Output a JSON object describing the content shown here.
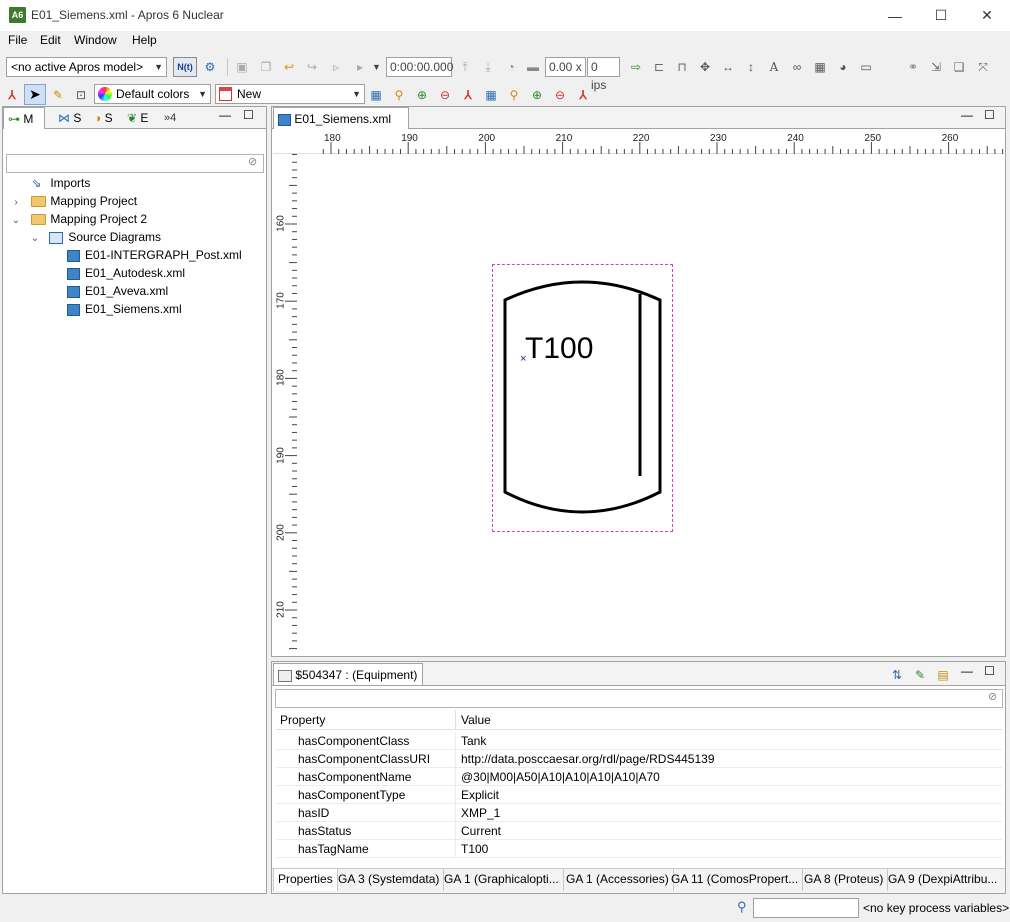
{
  "window": {
    "icon_text": "A6",
    "title": "E01_Siemens.xml - Apros 6 Nuclear",
    "minimize_glyph": "—",
    "maximize_glyph": "☐",
    "close_glyph": "✕"
  },
  "menu": [
    "File",
    "Edit",
    "Window",
    "Help"
  ],
  "toolbar1": {
    "model_combo": "<no active Apros model>",
    "time_field": "0:00:00.000",
    "speed_field": "0.00 x",
    "ips_field": "0 ips",
    "n_button": "N(t)"
  },
  "toolbar2": {
    "colors_combo": "Default colors",
    "new_combo": "New"
  },
  "left_panel": {
    "tabs": [
      "M",
      "S",
      "S",
      "E",
      "»4"
    ],
    "filter_placeholder": "",
    "tree": [
      {
        "label": "Imports",
        "type": "imports",
        "depth": 0,
        "expander": ""
      },
      {
        "label": "Mapping Project",
        "type": "folder",
        "depth": 0,
        "expander": "›"
      },
      {
        "label": "Mapping Project 2",
        "type": "folder",
        "depth": 0,
        "expander": "⌄"
      },
      {
        "label": "Source Diagrams",
        "type": "diagrams",
        "depth": 1,
        "expander": "⌄"
      },
      {
        "label": "E01-INTERGRAPH_Post.xml",
        "type": "diagram",
        "depth": 2,
        "expander": ""
      },
      {
        "label": "E01_Autodesk.xml",
        "type": "diagram",
        "depth": 2,
        "expander": ""
      },
      {
        "label": "E01_Aveva.xml",
        "type": "diagram",
        "depth": 2,
        "expander": ""
      },
      {
        "label": "E01_Siemens.xml",
        "type": "diagram",
        "depth": 2,
        "expander": ""
      }
    ]
  },
  "editor": {
    "tab_label": "E01_Siemens.xml",
    "ruler_top": [
      "180",
      "190",
      "200",
      "210",
      "220",
      "230",
      "240",
      "250",
      "260"
    ],
    "ruler_left": [
      "160",
      "170",
      "180",
      "190",
      "200",
      "210"
    ],
    "tank_label": "T100"
  },
  "properties": {
    "tab_label": "$504347 : (Equipment)",
    "col_property": "Property",
    "col_value": "Value",
    "rows": [
      {
        "key": "hasComponentClass",
        "value": "Tank"
      },
      {
        "key": "hasComponentClassURI",
        "value": "http://data.posccaesar.org/rdl/page/RDS445139"
      },
      {
        "key": "hasComponentName",
        "value": "@30|M00|A50|A10|A10|A10|A10|A70"
      },
      {
        "key": "hasComponentType",
        "value": "Explicit"
      },
      {
        "key": "hasID",
        "value": "XMP_1"
      },
      {
        "key": "hasStatus",
        "value": "Current"
      },
      {
        "key": "hasTagName",
        "value": "T100"
      }
    ],
    "bottom_tabs": [
      "Properties",
      "GA 3 (Systemdata)",
      "GA 1 (Graphicalopti...",
      "GA 1 (Accessories)",
      "GA 11 (ComosPropert...",
      "GA 8 (Proteus)",
      "GA 9 (DexpiAttribu..."
    ]
  },
  "status": {
    "key_variables": "<no key process variables>"
  }
}
